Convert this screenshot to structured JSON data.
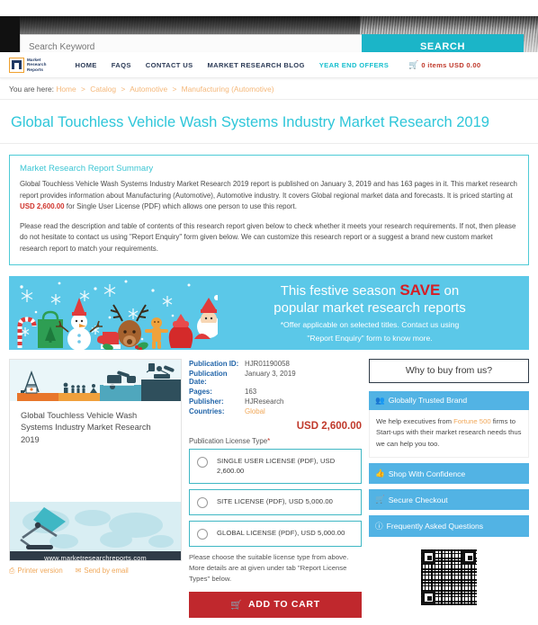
{
  "search": {
    "placeholder": "Search Keyword",
    "button_label": "SEARCH"
  },
  "brand": {
    "logo_line1": "Market",
    "logo_line2": "Research",
    "logo_line3": "Reports"
  },
  "nav": {
    "items": [
      {
        "label": "HOME",
        "accent": false
      },
      {
        "label": "FAQS",
        "accent": false
      },
      {
        "label": "CONTACT US",
        "accent": false
      },
      {
        "label": "MARKET RESEARCH BLOG",
        "accent": false
      },
      {
        "label": "YEAR END OFFERS",
        "accent": true
      }
    ],
    "cart_label": "0 items USD 0.00"
  },
  "breadcrumb": {
    "prefix": "You are here:",
    "items": [
      "Home",
      "Catalog",
      "Automotive",
      "Manufacturing (Automotive)"
    ],
    "separator": ">"
  },
  "page": {
    "title": "Global Touchless Vehicle Wash Systems Industry Market Research 2019"
  },
  "summary": {
    "heading": "Market Research Report Summary",
    "para1_a": "Global Touchless Vehicle Wash Systems Industry Market Research 2019 report is published on January 3, 2019 and has 163 pages in it. This market research report provides information about Manufacturing (Automotive), Automotive industry. It covers Global regional market data and forecasts. It is priced starting at ",
    "para1_price": "USD 2,600.00",
    "para1_b": " for Single User License (PDF) which allows one person to use this report.",
    "para2": "Please read the description and table of contents of this research report given below to check whether it meets your research requirements. If not, then please do not hesitate to contact us using \"Report Enquiry\" form given below. We can customize this research report or a suggest a brand new custom market research report to match your requirements."
  },
  "banner": {
    "line1_a": "This festive season ",
    "line1_save": "SAVE",
    "line1_b": " on",
    "line2": "popular market research reports",
    "note1": "*Offer applicable on selected titles. Contact us using",
    "note2": "\"Report Enquiry\" form to know more."
  },
  "cover": {
    "title": "Global Touchless Vehicle Wash Systems Industry Market Research 2019",
    "footer_url": "www.marketresearchreports.com"
  },
  "actions": {
    "printer_label": "Printer version",
    "printer_icon": "printer-icon",
    "email_label": "Send by email",
    "email_icon": "envelope-icon"
  },
  "details": {
    "rows": [
      {
        "key": "Publication ID:",
        "value": "HJR01190058",
        "style": "normal"
      },
      {
        "key": "Publication Date:",
        "value": "January 3, 2019",
        "style": "normal"
      },
      {
        "key": "Pages:",
        "value": "163",
        "style": "normal"
      },
      {
        "key": "Publisher:",
        "value": "HJResearch",
        "style": "normal"
      },
      {
        "key": "Countries:",
        "value": "Global",
        "style": "orange"
      }
    ],
    "price": "USD 2,600.00"
  },
  "license": {
    "label": "Publication License Type",
    "required_mark": "*",
    "options": [
      {
        "label": "SINGLE USER LICENSE (PDF), USD 2,600.00",
        "selected": false
      },
      {
        "label": "SITE LICENSE (PDF), USD 5,000.00",
        "selected": false
      },
      {
        "label": "GLOBAL LICENSE (PDF), USD 5,000.00",
        "selected": false
      }
    ],
    "note": "Please choose the suitable license type from above. More details are at given under tab \"Report License Types\" below."
  },
  "cart": {
    "button_label": "ADD TO CART",
    "button_icon": "cart-icon",
    "button_color": "#c0282d"
  },
  "sidebar": {
    "why_buy_label": "Why to buy from us?",
    "panels": [
      {
        "icon": "people-icon",
        "title": "Globally Trusted Brand",
        "body_a": "We help executives from ",
        "body_hl": "Fortune 500",
        "body_b": " firms to Start-ups with their market research needs thus we can help you too."
      }
    ],
    "bars": [
      {
        "icon": "thumbs-up-icon",
        "label": "Shop With Confidence"
      },
      {
        "icon": "cart-icon",
        "label": "Secure Checkout"
      },
      {
        "icon": "question-circle-icon",
        "label": "Frequently Asked Questions"
      }
    ],
    "qr_name": "qr-code"
  },
  "colors": {
    "accent_teal": "#2ec6d9",
    "brand_blue": "#52b3e4",
    "price_red": "#c0392b",
    "cart_red": "#c0282d",
    "link_orange": "#f0a85a"
  }
}
